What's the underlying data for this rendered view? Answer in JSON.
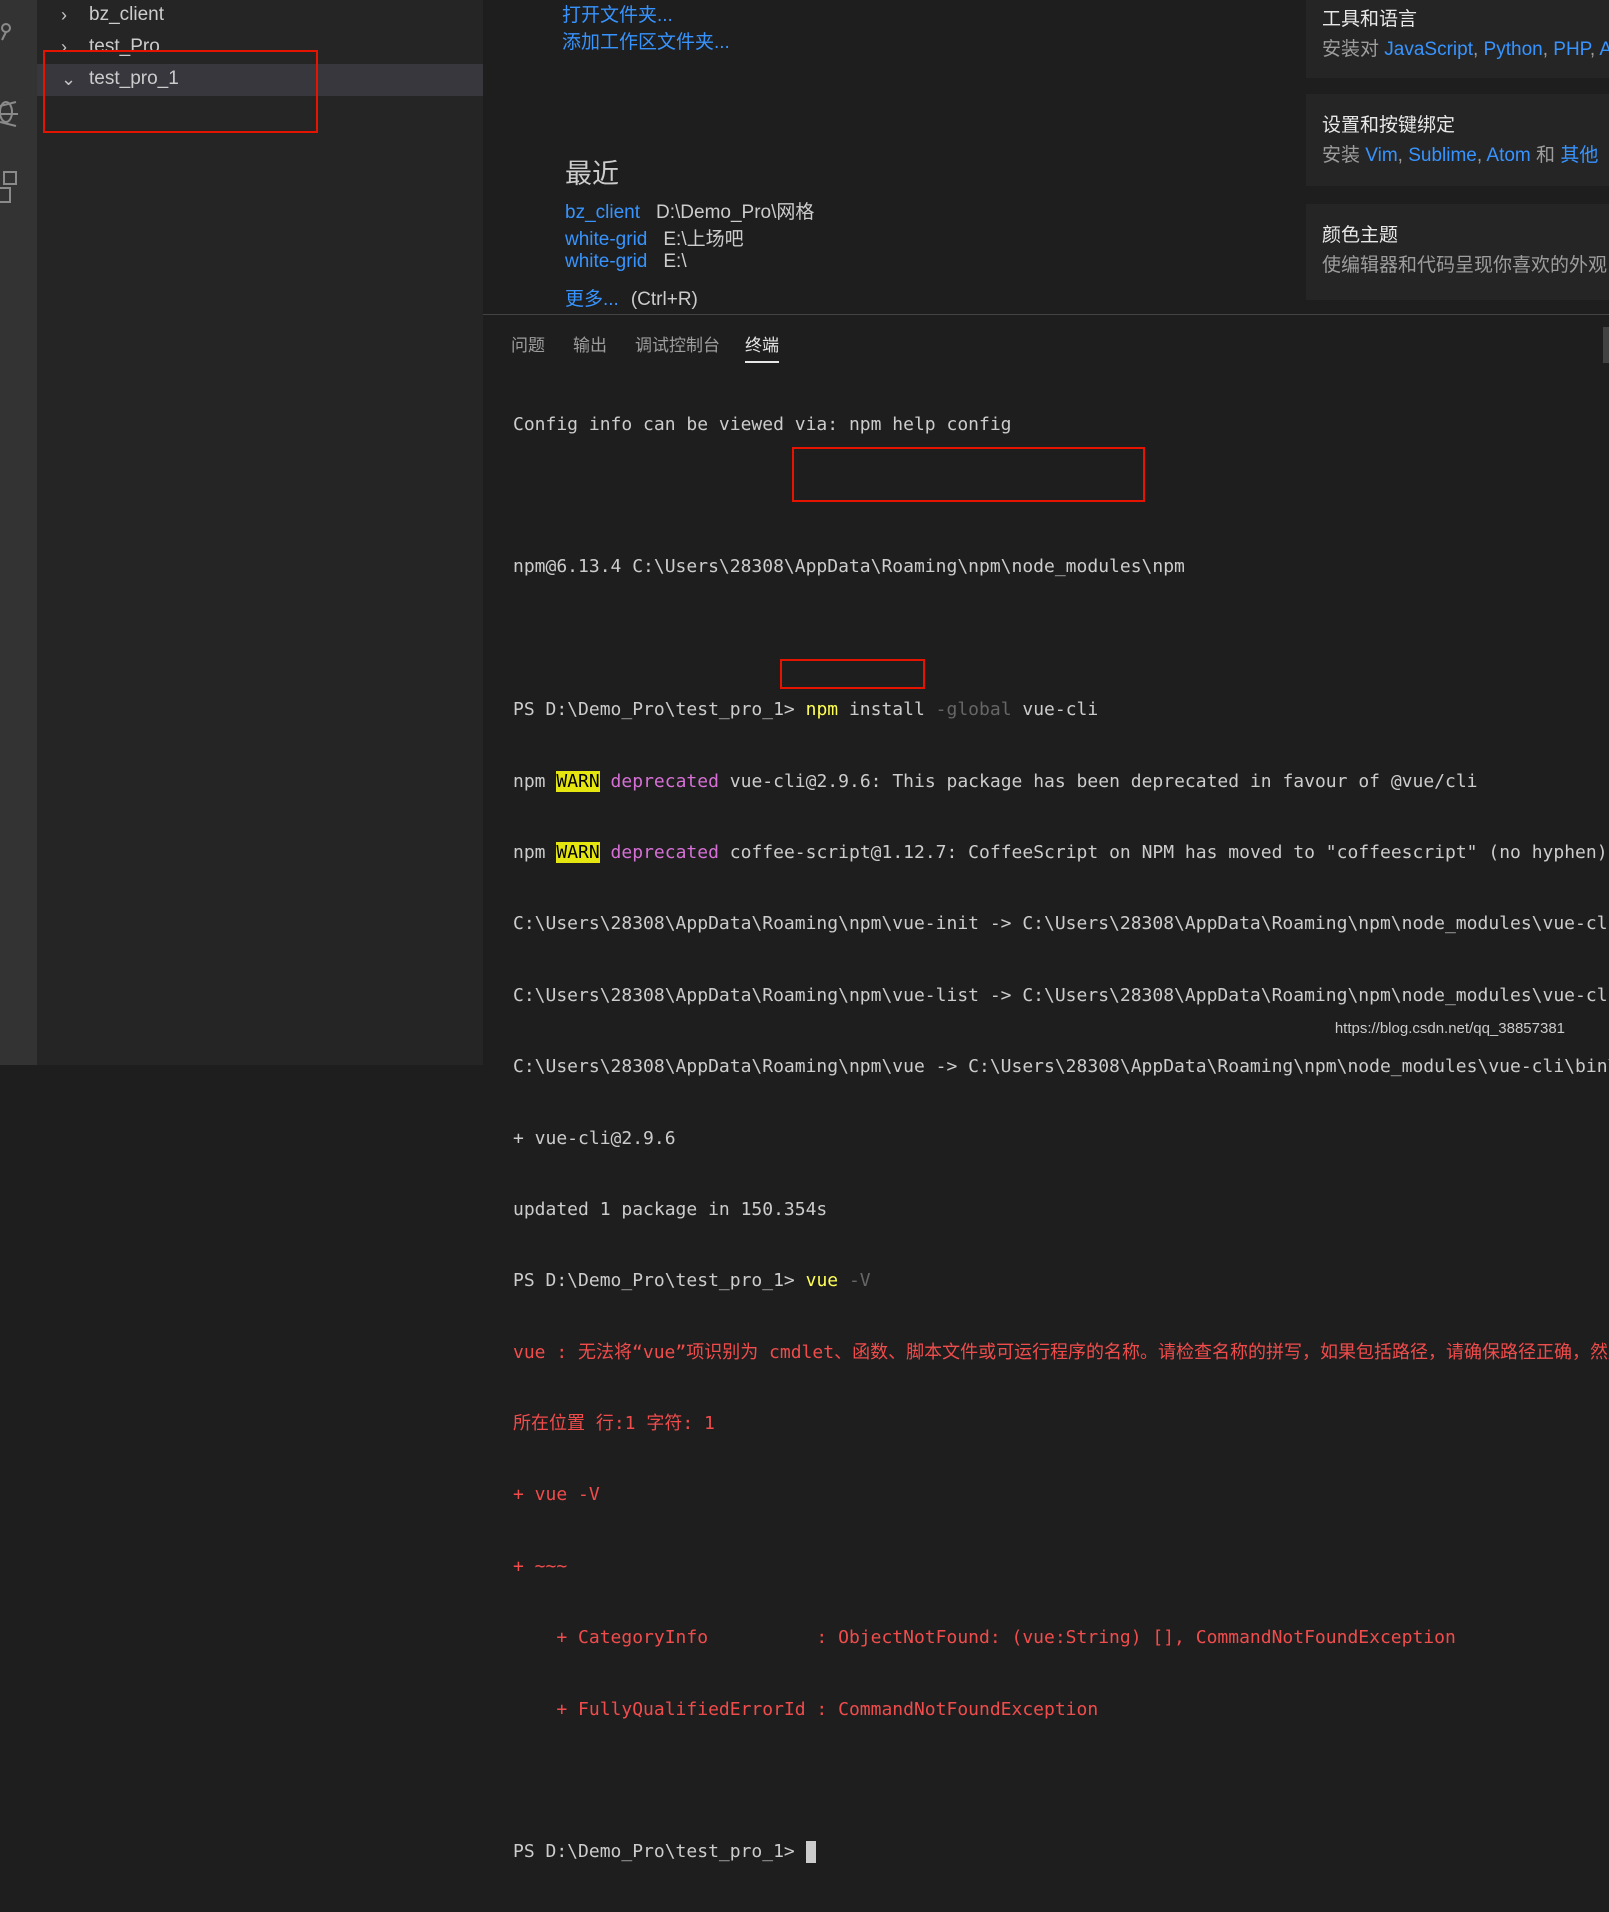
{
  "explorer": {
    "items": [
      {
        "label": "bz_client",
        "expanded": false
      },
      {
        "label": "test_Pro",
        "expanded": false
      },
      {
        "label": "test_pro_1",
        "expanded": true,
        "selected": true
      }
    ]
  },
  "welcome": {
    "start_links": {
      "open_folder": "打开文件夹...",
      "add_workspace_folder": "添加工作区文件夹..."
    },
    "recent": {
      "title": "最近",
      "items": [
        {
          "name": "bz_client",
          "path": "D:\\Demo_Pro\\网格"
        },
        {
          "name": "white-grid",
          "path": "E:\\上场吧"
        },
        {
          "name": "white-grid",
          "path": "E:\\"
        }
      ],
      "more_label": "更多...",
      "more_shortcut": "(Ctrl+R)"
    },
    "cards": [
      {
        "title": "工具和语言",
        "desc_prefix": "安装对 ",
        "links": [
          "JavaScript",
          "Python",
          "PHP",
          "Az"
        ],
        "sep": ", "
      },
      {
        "title": "设置和按键绑定",
        "desc_prefix": "安装 ",
        "links": [
          "Vim",
          "Sublime",
          "Atom"
        ],
        "and": " 和 ",
        "last_link": "其他"
      },
      {
        "title": "颜色主题",
        "desc": "使编辑器和代码呈现你喜欢的外观"
      }
    ]
  },
  "panel": {
    "tabs": [
      {
        "label": "问题",
        "active": false
      },
      {
        "label": "输出",
        "active": false
      },
      {
        "label": "调试控制台",
        "active": false
      },
      {
        "label": "终端",
        "active": true
      }
    ],
    "terminal": {
      "line_config": "Config info can be viewed via: npm help config",
      "line_npm_path": "npm@6.13.4 C:\\Users\\28308\\AppData\\Roaming\\npm\\node_modules\\npm",
      "prompt": "PS D:\\Demo_Pro\\test_pro_1>",
      "cmd1": {
        "a": "npm",
        "b": " install ",
        "c": "-global",
        "d": " vue-cli"
      },
      "warn": {
        "npm": "npm ",
        "badge": "WARN",
        "dep": " deprecated"
      },
      "warn1_rest": " vue-cli@2.9.6: This package has been deprecated in favour of @vue/cli",
      "warn2_rest": " coffee-script@1.12.7: CoffeeScript on NPM has moved to \"coffeescript\" (no hyphen)",
      "link1": "C:\\Users\\28308\\AppData\\Roaming\\npm\\vue-init -> C:\\Users\\28308\\AppData\\Roaming\\npm\\node_modules\\vue-cli\\bin\\vue-init",
      "link2": "C:\\Users\\28308\\AppData\\Roaming\\npm\\vue-list -> C:\\Users\\28308\\AppData\\Roaming\\npm\\node_modules\\vue-cli\\bin\\vue-list",
      "link3": "C:\\Users\\28308\\AppData\\Roaming\\npm\\vue -> C:\\Users\\28308\\AppData\\Roaming\\npm\\node_modules\\vue-cli\\bin\\vue",
      "added": "+ vue-cli@2.9.6",
      "updated": "updated 1 package in 150.354s",
      "cmd2": {
        "a": "vue",
        "b": " -V"
      },
      "err1": "vue : 无法将“vue”项识别为 cmdlet、函数、脚本文件或可运行程序的名称。请检查名称的拼写，如果包括路径，请确保路径正确，然后再试一次。",
      "err2": "所在位置 行:1 字符: 1",
      "err3": "+ vue -V",
      "err4": "+ ~~~",
      "err5": "    + CategoryInfo          : ObjectNotFound: (vue:String) [], CommandNotFoundException",
      "err6": "    + FullyQualifiedErrorId : CommandNotFoundException"
    }
  },
  "watermark": "https://blog.csdn.net/qq_38857381"
}
